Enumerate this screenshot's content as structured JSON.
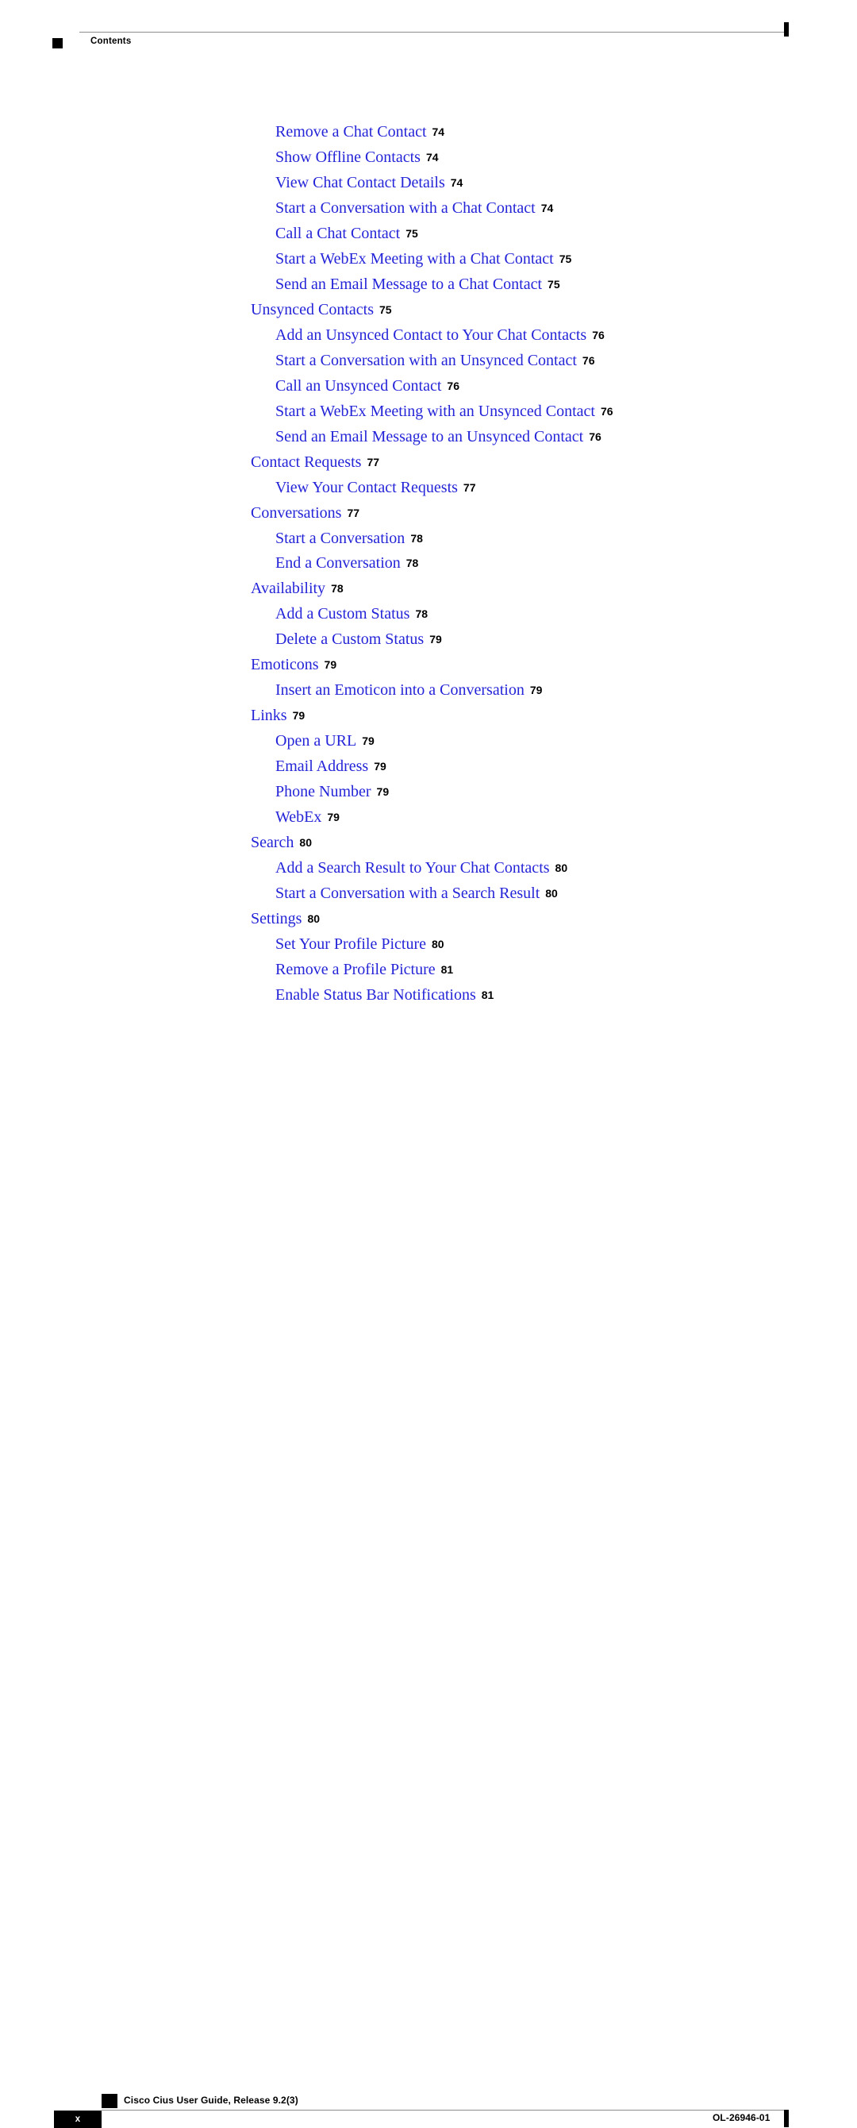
{
  "header": {
    "section_label": "Contents",
    "marker_icon": "black-square-marker",
    "change_bar_icon": "vertical-change-bar"
  },
  "toc": {
    "entries": [
      {
        "level": 2,
        "title": "Remove a Chat Contact",
        "page": "74"
      },
      {
        "level": 2,
        "title": "Show Offline Contacts",
        "page": "74"
      },
      {
        "level": 2,
        "title": "View Chat Contact Details",
        "page": "74"
      },
      {
        "level": 2,
        "title": "Start a Conversation with a Chat Contact",
        "page": "74"
      },
      {
        "level": 2,
        "title": "Call a Chat Contact",
        "page": "75"
      },
      {
        "level": 2,
        "title": "Start a WebEx Meeting with a Chat Contact",
        "page": "75"
      },
      {
        "level": 2,
        "title": "Send an Email Message to a Chat Contact",
        "page": "75"
      },
      {
        "level": 1,
        "title": "Unsynced Contacts",
        "page": "75"
      },
      {
        "level": 2,
        "title": "Add an Unsynced Contact to Your Chat Contacts",
        "page": "76"
      },
      {
        "level": 2,
        "title": "Start a Conversation with an Unsynced Contact",
        "page": "76"
      },
      {
        "level": 2,
        "title": "Call an Unsynced Contact",
        "page": "76"
      },
      {
        "level": 2,
        "title": "Start a WebEx Meeting with an Unsynced Contact",
        "page": "76"
      },
      {
        "level": 2,
        "title": "Send an Email Message to an Unsynced Contact",
        "page": "76"
      },
      {
        "level": 1,
        "title": "Contact Requests",
        "page": "77"
      },
      {
        "level": 2,
        "title": "View Your Contact Requests",
        "page": "77"
      },
      {
        "level": 1,
        "title": "Conversations",
        "page": "77"
      },
      {
        "level": 2,
        "title": "Start a Conversation",
        "page": "78"
      },
      {
        "level": 2,
        "title": "End a Conversation",
        "page": "78"
      },
      {
        "level": 1,
        "title": "Availability",
        "page": "78"
      },
      {
        "level": 2,
        "title": "Add a Custom Status",
        "page": "78"
      },
      {
        "level": 2,
        "title": "Delete a Custom Status",
        "page": "79"
      },
      {
        "level": 1,
        "title": "Emoticons",
        "page": "79"
      },
      {
        "level": 2,
        "title": "Insert an Emoticon into a Conversation",
        "page": "79"
      },
      {
        "level": 1,
        "title": "Links",
        "page": "79"
      },
      {
        "level": 2,
        "title": "Open a URL",
        "page": "79"
      },
      {
        "level": 2,
        "title": "Email Address",
        "page": "79"
      },
      {
        "level": 2,
        "title": "Phone Number",
        "page": "79"
      },
      {
        "level": 2,
        "title": "WebEx",
        "page": "79"
      },
      {
        "level": 1,
        "title": "Search",
        "page": "80"
      },
      {
        "level": 2,
        "title": "Add a Search Result to Your Chat Contacts",
        "page": "80"
      },
      {
        "level": 2,
        "title": "Start a Conversation with a Search Result",
        "page": "80"
      },
      {
        "level": 1,
        "title": "Settings",
        "page": "80"
      },
      {
        "level": 2,
        "title": "Set Your Profile Picture",
        "page": "80"
      },
      {
        "level": 2,
        "title": "Remove a Profile Picture",
        "page": "81"
      },
      {
        "level": 2,
        "title": "Enable Status Bar Notifications",
        "page": "81"
      }
    ]
  },
  "footer": {
    "document_title": "Cisco Cius User Guide, Release 9.2(3)",
    "page_number": "x",
    "document_id": "OL-26946-01",
    "marker_icon": "black-square-marker",
    "change_bar_icon": "vertical-change-bar"
  },
  "colors": {
    "link_blue": "#2424d8",
    "rule_gray": "#8c8c8c",
    "marker_black": "#000000"
  }
}
